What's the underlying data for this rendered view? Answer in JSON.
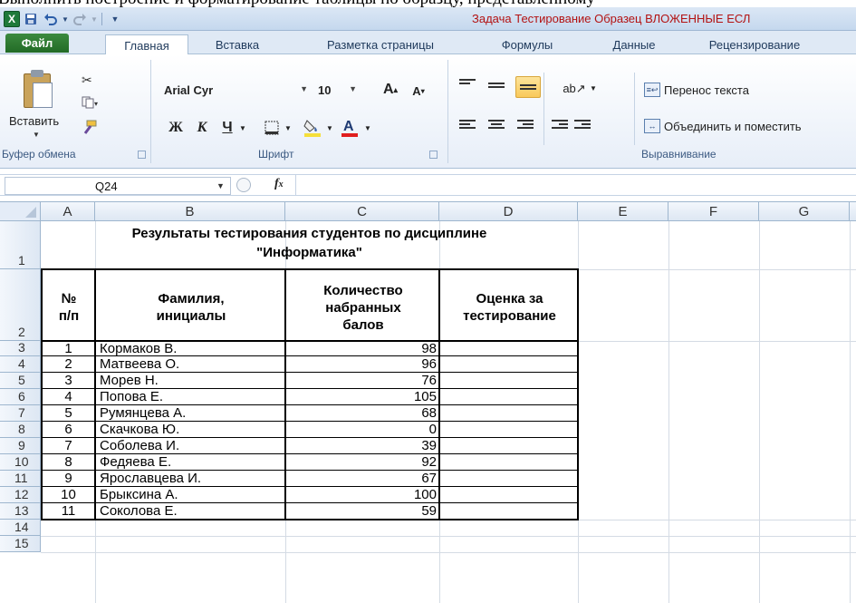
{
  "doc_fragment": "Выполнить построение и форматирование таблицы по образцу, представленному",
  "window": {
    "title": "Задача Тестирование Образец ВЛОЖЕННЫЕ  ЕСЛ"
  },
  "qat": {
    "app_icon": "X",
    "save": "save-icon",
    "undo": "undo-icon",
    "redo": "redo-icon"
  },
  "tabs": [
    "Файл",
    "Главная",
    "Вставка",
    "Разметка страницы",
    "Формулы",
    "Данные",
    "Рецензирование"
  ],
  "ribbon": {
    "clipboard": {
      "paste": "Вставить",
      "label": "Буфер обмена"
    },
    "font": {
      "name": "Arial Cyr",
      "size": "10",
      "bold": "Ж",
      "italic": "К",
      "underline": "Ч",
      "label": "Шрифт"
    },
    "alignment": {
      "wrap": "Перенос текста",
      "merge": "Объединить и поместить",
      "label": "Выравнивание"
    }
  },
  "formula_bar": {
    "name_box": "Q24",
    "fx": "fx",
    "formula": ""
  },
  "grid": {
    "columns": [
      "A",
      "B",
      "C",
      "D",
      "E",
      "F",
      "G"
    ],
    "rows": [
      "1",
      "2",
      "3",
      "4",
      "5",
      "6",
      "7",
      "8",
      "9",
      "10",
      "11",
      "12",
      "13",
      "14",
      "15"
    ]
  },
  "sheet": {
    "title_line1": "Результаты тестирования студентов по дисциплине",
    "title_line2": "\"Информатика\"",
    "headers": {
      "num_1": "№",
      "num_2": "п/п",
      "name_1": "Фамилия,",
      "name_2": "инициалы",
      "score_1": "Количество",
      "score_2": "набранных",
      "score_3": "балов",
      "grade_1": "Оценка за",
      "grade_2": "тестирование"
    },
    "rows": [
      {
        "n": "1",
        "name": "Кормаков В.",
        "score": "98"
      },
      {
        "n": "2",
        "name": "Матвеева О.",
        "score": "96"
      },
      {
        "n": "3",
        "name": "Морев Н.",
        "score": "76"
      },
      {
        "n": "4",
        "name": "Попова Е.",
        "score": "105"
      },
      {
        "n": "5",
        "name": "Румянцева А.",
        "score": "68"
      },
      {
        "n": "6",
        "name": "Скачкова Ю.",
        "score": "0"
      },
      {
        "n": "7",
        "name": "Соболева И.",
        "score": "39"
      },
      {
        "n": "8",
        "name": "Федяева Е.",
        "score": "92"
      },
      {
        "n": "9",
        "name": "Ярославцева И.",
        "score": "67"
      },
      {
        "n": "10",
        "name": "Брыксина А.",
        "score": "100"
      },
      {
        "n": "11",
        "name": "Соколова Е.",
        "score": "59"
      }
    ]
  }
}
